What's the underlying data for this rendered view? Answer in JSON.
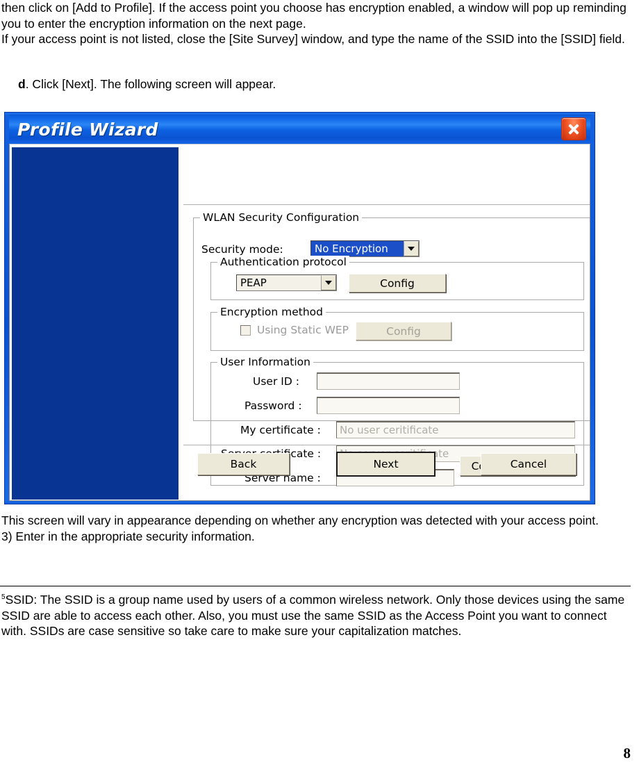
{
  "document": {
    "intro_paragraph": "then click on [Add to Profile]. If the access point you choose has encryption enabled, a window will pop up reminding you to enter the encryption information on the next page.\nIf your access point is not listed, close the [Site Survey] window, and type the name of the SSID into the [SSID] field.",
    "step_marker": "d",
    "step_text": ". Click [Next]. The following screen will appear.",
    "after_image_paragraph": "This screen will vary in appearance depending on whether any encryption was detected with your access point.\n3) Enter in the appropriate security information.",
    "footnote_marker": "5",
    "footnote_text": "SSID: The SSID is a group name used by users of a common wireless network. Only those devices using the same SSID are able to access each other. Also, you must use the same SSID as the Access Point you want to connect with. SSIDs are case sensitive so take care to make sure your capitalization matches.",
    "page_number": "8"
  },
  "dialog": {
    "title": "Profile Wizard",
    "close_icon": "close-icon",
    "colors": {
      "titlebar_blue": "#0d62e2",
      "side_banner_blue": "#083594",
      "close_red": "#f05324",
      "selected_blue": "#1b4fc8",
      "button_face": "#ece9d8"
    },
    "wlan_group": {
      "legend": "WLAN Security Configuration",
      "security_mode_label": "Security mode:",
      "security_mode_value": "No Encryption",
      "security_mode_selected": true
    },
    "auth_group": {
      "legend": "Authentication protocol",
      "protocol_value": "PEAP",
      "config_label": "Config"
    },
    "encryption_group": {
      "legend": "Encryption method",
      "checkbox_label": "Using Static WEP",
      "checkbox_checked": false,
      "checkbox_disabled": true,
      "config_label": "Config",
      "config_disabled": true
    },
    "user_information": {
      "legend": "User Information",
      "user_id_label": "User ID :",
      "user_id_value": "",
      "password_label": "Password :",
      "password_value": "",
      "my_certificate_label": "My certificate :",
      "my_certificate_placeholder": "No user ceritificate",
      "server_certificate_label": "Server certificate :",
      "server_certificate_placeholder": "No server ceritificate",
      "server_name_label": "Server name :",
      "server_name_value": "",
      "config_certificate_label": "Config certificate"
    },
    "footer": {
      "back_label": "Back",
      "next_label": "Next",
      "cancel_label": "Cancel",
      "default_button": "Next"
    }
  }
}
